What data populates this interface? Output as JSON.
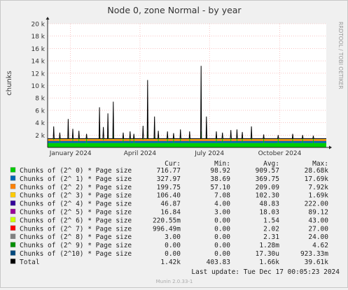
{
  "chart_data": {
    "type": "area",
    "title": "Node 0, zone Normal - by year",
    "ylabel": "chunks",
    "side_label": "RRDTOOL / TOBI OETIKER",
    "ylim": [
      0,
      20000
    ],
    "y_ticks": [
      {
        "value": 2000,
        "label": "2 k"
      },
      {
        "value": 4000,
        "label": "4 k"
      },
      {
        "value": 6000,
        "label": "6 k"
      },
      {
        "value": 8000,
        "label": "8 k"
      },
      {
        "value": 10000,
        "label": "10 k"
      },
      {
        "value": 12000,
        "label": "12 k"
      },
      {
        "value": 14000,
        "label": "14 k"
      },
      {
        "value": 16000,
        "label": "16 k"
      },
      {
        "value": 18000,
        "label": "18 k"
      },
      {
        "value": 20000,
        "label": "20 k"
      }
    ],
    "x_domain": [
      0,
      365
    ],
    "x_ticks": [
      {
        "value": 30,
        "label": "January 2024"
      },
      {
        "value": 121,
        "label": "April 2024"
      },
      {
        "value": 212,
        "label": "July 2024"
      },
      {
        "value": 304,
        "label": "October 2024"
      }
    ],
    "baseline": {
      "stack": [
        {
          "value": 720,
          "color": "#00cc00"
        },
        {
          "value": 330,
          "color": "#0066b3"
        },
        {
          "value": 200,
          "color": "#ff8000"
        },
        {
          "value": 105,
          "color": "#ffcc00"
        },
        {
          "value": 45,
          "color": "#330099"
        }
      ],
      "total": 1420
    },
    "spikes": [
      {
        "x": 8,
        "y": 3400
      },
      {
        "x": 16,
        "y": 2400
      },
      {
        "x": 27,
        "y": 4600
      },
      {
        "x": 33,
        "y": 3000
      },
      {
        "x": 41,
        "y": 2700
      },
      {
        "x": 51,
        "y": 2200
      },
      {
        "x": 68,
        "y": 6500
      },
      {
        "x": 73,
        "y": 3300
      },
      {
        "x": 79,
        "y": 5500
      },
      {
        "x": 86,
        "y": 7400
      },
      {
        "x": 99,
        "y": 2400
      },
      {
        "x": 108,
        "y": 2600
      },
      {
        "x": 113,
        "y": 2200
      },
      {
        "x": 125,
        "y": 3500
      },
      {
        "x": 131,
        "y": 10900
      },
      {
        "x": 140,
        "y": 5000
      },
      {
        "x": 145,
        "y": 2700
      },
      {
        "x": 157,
        "y": 2600
      },
      {
        "x": 165,
        "y": 2300
      },
      {
        "x": 174,
        "y": 2900
      },
      {
        "x": 186,
        "y": 2600
      },
      {
        "x": 201,
        "y": 13200
      },
      {
        "x": 208,
        "y": 5000
      },
      {
        "x": 221,
        "y": 2600
      },
      {
        "x": 229,
        "y": 2400
      },
      {
        "x": 240,
        "y": 2800
      },
      {
        "x": 248,
        "y": 2900
      },
      {
        "x": 255,
        "y": 2500
      },
      {
        "x": 267,
        "y": 3400
      },
      {
        "x": 283,
        "y": 2100
      },
      {
        "x": 302,
        "y": 2000
      },
      {
        "x": 321,
        "y": 2200
      },
      {
        "x": 334,
        "y": 2000
      },
      {
        "x": 348,
        "y": 1900
      }
    ],
    "legend_headers": {
      "cur": "Cur:",
      "min": "Min:",
      "avg": "Avg:",
      "max": "Max:"
    },
    "series": [
      {
        "name": "Chunks of (2^ 0) * Page size",
        "color": "#00cc00",
        "cur": "716.77",
        "min": "98.92",
        "avg": "909.57",
        "max": "28.68k"
      },
      {
        "name": "Chunks of (2^ 1) * Page size",
        "color": "#0066b3",
        "cur": "327.97",
        "min": "38.69",
        "avg": "369.75",
        "max": "17.69k"
      },
      {
        "name": "Chunks of (2^ 2) * Page size",
        "color": "#ff8000",
        "cur": "199.75",
        "min": "57.10",
        "avg": "209.09",
        "max": "7.92k"
      },
      {
        "name": "Chunks of (2^ 3) * Page size",
        "color": "#ffcc00",
        "cur": "106.40",
        "min": "7.08",
        "avg": "102.30",
        "max": "1.69k"
      },
      {
        "name": "Chunks of (2^ 4) * Page size",
        "color": "#330099",
        "cur": "46.87",
        "min": "4.00",
        "avg": "48.83",
        "max": "222.00"
      },
      {
        "name": "Chunks of (2^ 5) * Page size",
        "color": "#990099",
        "cur": "16.84",
        "min": "3.00",
        "avg": "18.03",
        "max": "89.12"
      },
      {
        "name": "Chunks of (2^ 6) * Page size",
        "color": "#ccff00",
        "cur": "220.55m",
        "min": "0.00",
        "avg": "1.54",
        "max": "43.00"
      },
      {
        "name": "Chunks of (2^ 7) * Page size",
        "color": "#ff0000",
        "cur": "996.49m",
        "min": "0.00",
        "avg": "2.02",
        "max": "27.00"
      },
      {
        "name": "Chunks of (2^ 8) * Page size",
        "color": "#808080",
        "cur": "3.00",
        "min": "0.00",
        "avg": "2.31",
        "max": "24.00"
      },
      {
        "name": "Chunks of (2^ 9) * Page size",
        "color": "#008f00",
        "cur": "0.00",
        "min": "0.00",
        "avg": "1.28m",
        "max": "4.62"
      },
      {
        "name": "Chunks of (2^10) * Page size",
        "color": "#00487d",
        "cur": "0.00",
        "min": "0.00",
        "avg": "17.30u",
        "max": "923.33m"
      },
      {
        "name": "Total",
        "color": "#000000",
        "cur": "1.42k",
        "min": "403.83",
        "avg": "1.66k",
        "max": "39.61k"
      }
    ],
    "last_update": "Last update:  Tue Dec 17 00:05:23 2024",
    "footer": "Munin 2.0.33-1"
  }
}
